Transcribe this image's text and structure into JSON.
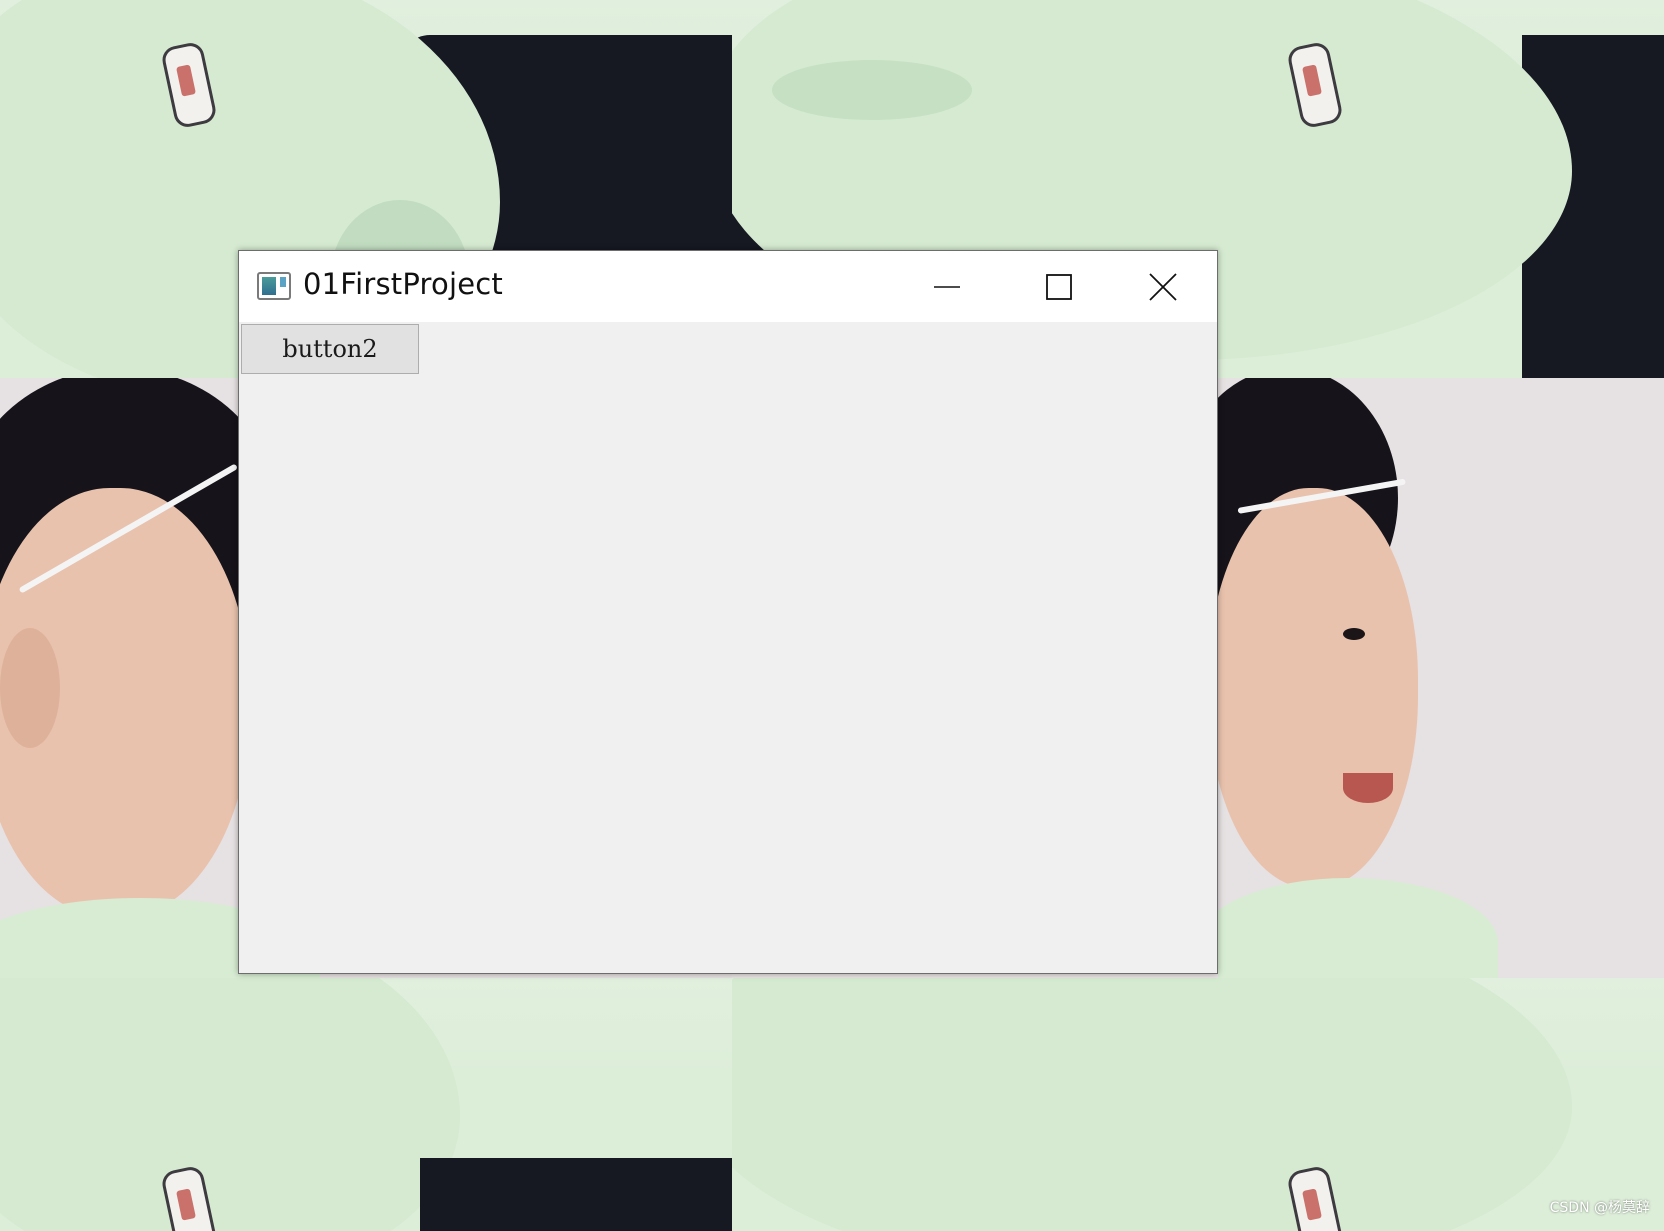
{
  "wallpaper": {
    "colors": {
      "shirt": "#dcedd8",
      "wall": "#e6e1e2",
      "dark_background": "#161822",
      "hair": "#16141a",
      "skin": "#e8c2ad"
    }
  },
  "window": {
    "title": "01FirstProject",
    "icon": "app-window-icon",
    "controls": {
      "minimize": "minimize-icon",
      "maximize": "maximize-icon",
      "close": "close-icon"
    },
    "colors": {
      "titlebar": "#ffffff",
      "client": "#f0f0f0",
      "button": "#e1e1e1"
    }
  },
  "content": {
    "button2_label": "button2"
  },
  "watermark": {
    "text": "CSDN @杨莫辞"
  }
}
